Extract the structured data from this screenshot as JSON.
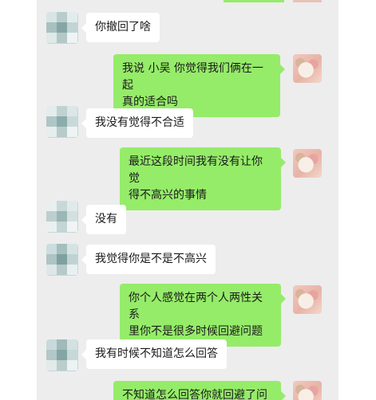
{
  "messages": [
    {
      "side": "left",
      "text": "你撤回了啥"
    },
    {
      "side": "right",
      "lines": [
        "我说 小吴 你觉得我们俩在一起",
        "真的适合吗"
      ]
    },
    {
      "side": "left",
      "text": "我没有觉得不合适"
    },
    {
      "side": "right",
      "lines": [
        "最近这段时间我有没有让你觉",
        "得不高兴的事情"
      ]
    },
    {
      "side": "left",
      "text": "没有"
    },
    {
      "side": "left",
      "text": "我觉得你是不是不高兴"
    },
    {
      "side": "right",
      "lines": [
        "你个人感觉在两个人两性关系",
        "里你不是很多时候回避问题"
      ]
    },
    {
      "side": "left",
      "text": "我有时候不知道怎么回答"
    },
    {
      "side": "right",
      "lines": [
        "不知道怎么回答你就回避了问"
      ]
    }
  ],
  "colors": {
    "chat_background": "#ededed",
    "my_bubble": "#95ec69",
    "their_bubble": "#ffffff"
  }
}
